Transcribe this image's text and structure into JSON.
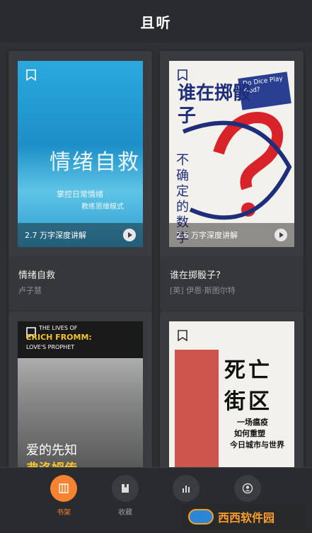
{
  "header": {
    "title": "且听"
  },
  "books": [
    {
      "title": "情绪自救",
      "author": "卢子慧",
      "duration": "2.7 万字深度讲解",
      "cover": {
        "main": "情绪自救",
        "sub1": "掌控日常情绪",
        "sub2": "教练思维模式"
      }
    },
    {
      "title": "谁在掷骰子?",
      "author": "[英] 伊恩·斯图尔特",
      "duration": "2.6 万字深度讲解",
      "cover": {
        "main": "谁在掷骰子",
        "vertical": "不确定的数学",
        "badge": "Do Dice Play God?"
      }
    },
    {
      "title": "",
      "author": "",
      "cover": {
        "top1": "THE LIVES OF",
        "top2": "ERICH FROMM:",
        "top3": "LOVE'S PROPHET",
        "main1": "爱的先知",
        "main2": "弗洛姆传"
      }
    },
    {
      "title": "",
      "author": "",
      "cover": {
        "main1": "死亡",
        "main2": "街区",
        "sub1": "一场瘟疫",
        "sub2": "如何重塑",
        "sub3": "今日城市与世界"
      }
    }
  ],
  "nav": [
    {
      "label": "书架",
      "icon": "bookshelf-icon",
      "active": true
    },
    {
      "label": "收藏",
      "icon": "bookmark-book-icon",
      "active": false
    },
    {
      "label": "",
      "icon": "bar-chart-icon",
      "active": false
    },
    {
      "label": "",
      "icon": "profile-icon",
      "active": false
    }
  ],
  "watermark": {
    "text": "西西软件园"
  },
  "colors": {
    "accent": "#f7822f",
    "background": "#2f3033",
    "card": "#3a3b3f"
  }
}
